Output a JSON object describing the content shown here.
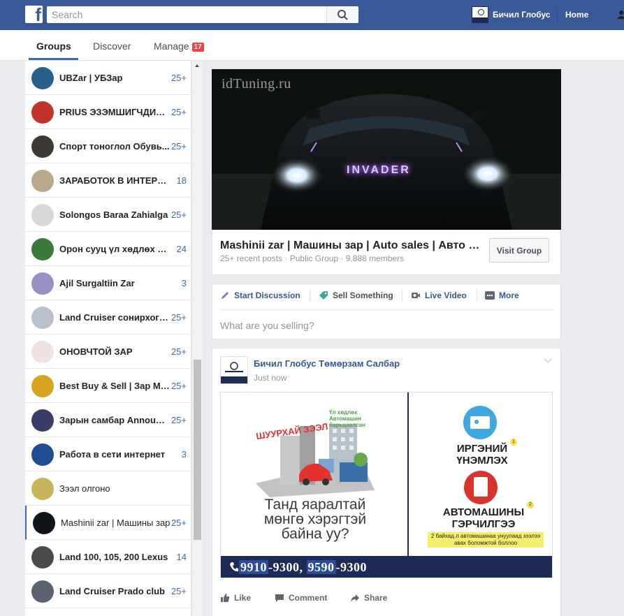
{
  "topbar": {
    "logo_letter": "f",
    "search_placeholder": "Search",
    "profile_name": "Бичил Глобус",
    "home_label": "Home"
  },
  "subnav": {
    "tabs": [
      {
        "label": "Groups"
      },
      {
        "label": "Discover"
      },
      {
        "label": "Manage",
        "badge": "17"
      }
    ]
  },
  "sidebar": {
    "groups": [
      {
        "name": "UBZar | УБЗар",
        "count": "25+",
        "color": "#2a5f8a"
      },
      {
        "name": "PRIUS ЭЗЭМШИГЧДИЙН...",
        "count": "25+",
        "color": "#c0342b"
      },
      {
        "name": "Спорт тоноглол Обувь...",
        "count": "25+",
        "color": "#3d3a35"
      },
      {
        "name": "ЗАРАБОТОК В ИНТЕРНЕТЕ",
        "count": "18",
        "color": "#b9a98a"
      },
      {
        "name": "Solongos Baraa Zahialga",
        "count": "25+",
        "color": "#d7d7d7"
      },
      {
        "name": "Орон сууц үл хөдлөх хөрөнгө",
        "count": "24",
        "color": "#3a7a3a"
      },
      {
        "name": "Ajil Surgaltiin Zar",
        "count": "3",
        "color": "#9a8fc4"
      },
      {
        "name": "Land Cruiser сонирхогчид",
        "count": "25+",
        "color": "#b8c0cc"
      },
      {
        "name": "ОНОВЧТОЙ ЗАР",
        "count": "25+",
        "color": "#f0e2e2"
      },
      {
        "name": "Best Buy & Sell | Зар Мэдээ",
        "count": "25+",
        "color": "#d7a321"
      },
      {
        "name": "Зарын самбар Announcement",
        "count": "25+",
        "color": "#3a3c6a"
      },
      {
        "name": "Работа в сети интернет",
        "count": "3",
        "color": "#1f4b8f"
      },
      {
        "name": "Зээл олгоно",
        "count": "",
        "color": "#c8b45a"
      },
      {
        "name": "Mashinii zar | Машины зар",
        "count": "25+",
        "color": "#111418"
      },
      {
        "name": "Land 100, 105, 200 Lexus",
        "count": "14",
        "color": "#4a4a4a"
      },
      {
        "name": "Land Cruiser Prado club",
        "count": "25+",
        "color": "#5a6270"
      }
    ]
  },
  "group": {
    "cover_watermark": "idTuning.ru",
    "cover_badge": "INVADER",
    "title": "Mashinii zar | Машины зар | Auto sales | Авто зар",
    "meta": "25+ recent posts · Public Group · 9,888 members",
    "visit_label": "Visit Group"
  },
  "composer": {
    "actions": [
      {
        "label": "Start Discussion"
      },
      {
        "label": "Sell Something"
      },
      {
        "label": "Live Video"
      },
      {
        "label": "More"
      }
    ],
    "placeholder": "What are you selling?"
  },
  "post": {
    "author": "Бичил Глобус Төмөрзам Салбар",
    "time": "Just now",
    "ad": {
      "tag_loan": "ШУУРХАЙ ЗЭЭЛ",
      "tag_realestate": "Үл хөдлөх Автомашин барьцаалсан",
      "slogan": "Танд яаралтай мөнгө хэрэгтэй байна уу?",
      "right_1": "ИРГЭНИЙ ҮНЭМЛЭХ",
      "right_2": "АВТОМАШИНЫ ГЭРЧИЛГЭЭ",
      "note": "2 байхад л автомашинаа унуулаад зээлээ авах боломжтой боллоо",
      "phone_1a": "9910",
      "phone_1b": "-9300,",
      "phone_2a": "9590",
      "phone_2b": "-9300",
      "num_1": "1",
      "num_2": "2"
    },
    "actions": [
      {
        "label": "Like"
      },
      {
        "label": "Comment"
      },
      {
        "label": "Share"
      }
    ]
  }
}
